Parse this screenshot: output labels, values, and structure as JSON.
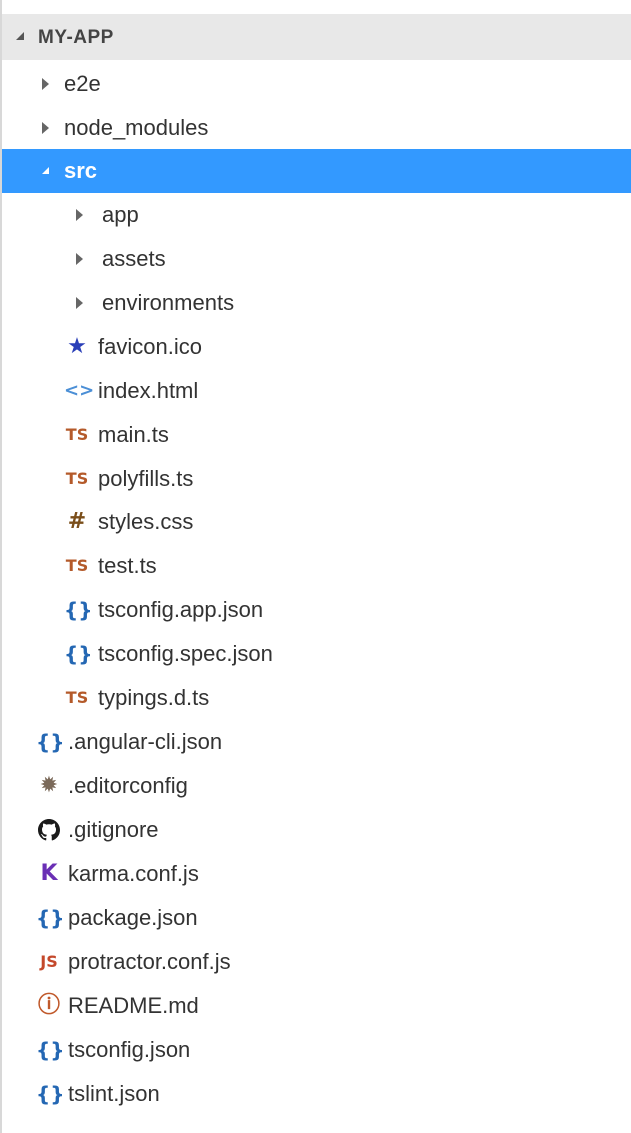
{
  "explorer": {
    "title": "MY-APP"
  },
  "colors": {
    "selected_bg": "#3399ff",
    "header_bg": "#e8e8e8"
  },
  "tree": [
    {
      "label": "e2e",
      "type": "folder",
      "expanded": false
    },
    {
      "label": "node_modules",
      "type": "folder",
      "expanded": false
    },
    {
      "label": "src",
      "type": "folder",
      "expanded": true,
      "selected": true
    },
    {
      "label": "app",
      "type": "folder",
      "expanded": false
    },
    {
      "label": "assets",
      "type": "folder",
      "expanded": false
    },
    {
      "label": "environments",
      "type": "folder",
      "expanded": false
    },
    {
      "label": "favicon.ico",
      "icon": "star-icon",
      "glyph": "★"
    },
    {
      "label": "index.html",
      "icon": "html-icon",
      "glyph": "<>"
    },
    {
      "label": "main.ts",
      "icon": "typescript-icon",
      "glyph": "TS"
    },
    {
      "label": "polyfills.ts",
      "icon": "typescript-icon",
      "glyph": "TS"
    },
    {
      "label": "styles.css",
      "icon": "css-icon",
      "glyph": "#"
    },
    {
      "label": "test.ts",
      "icon": "typescript-icon",
      "glyph": "TS"
    },
    {
      "label": "tsconfig.app.json",
      "icon": "json-icon",
      "glyph": "{}"
    },
    {
      "label": "tsconfig.spec.json",
      "icon": "json-icon",
      "glyph": "{}"
    },
    {
      "label": "typings.d.ts",
      "icon": "typescript-icon",
      "glyph": "TS"
    },
    {
      "label": ".angular-cli.json",
      "icon": "json-icon",
      "glyph": "{}"
    },
    {
      "label": ".editorconfig",
      "icon": "gear-icon",
      "glyph": "✹"
    },
    {
      "label": ".gitignore",
      "icon": "github-icon",
      "glyph": "◐"
    },
    {
      "label": "karma.conf.js",
      "icon": "karma-icon",
      "glyph": "K"
    },
    {
      "label": "package.json",
      "icon": "json-icon",
      "glyph": "{}"
    },
    {
      "label": "protractor.conf.js",
      "icon": "javascript-icon",
      "glyph": "JS"
    },
    {
      "label": "README.md",
      "icon": "info-icon",
      "glyph": "ⓘ"
    },
    {
      "label": "tsconfig.json",
      "icon": "json-icon",
      "glyph": "{}"
    },
    {
      "label": "tslint.json",
      "icon": "json-icon",
      "glyph": "{}"
    }
  ]
}
